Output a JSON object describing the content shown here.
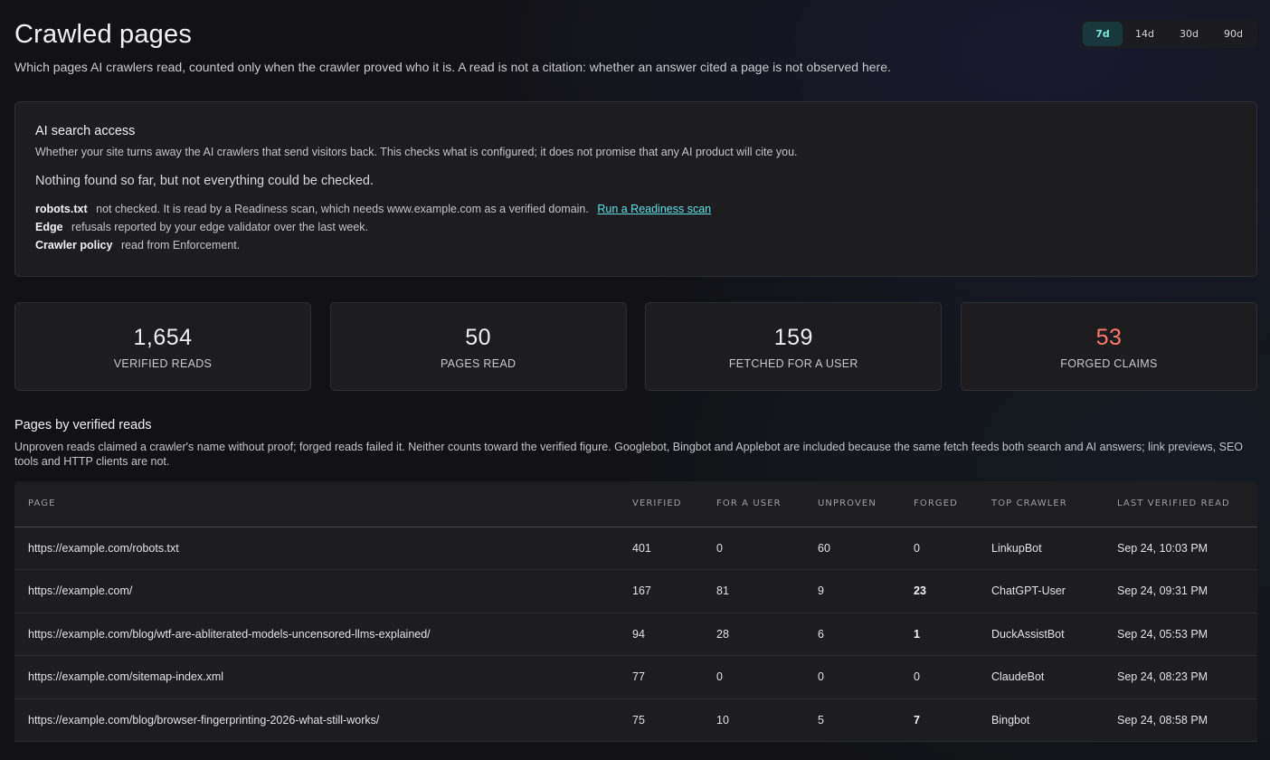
{
  "header": {
    "title": "Crawled pages",
    "subtitle": "Which pages AI crawlers read, counted only when the crawler proved who it is. A read is not a citation: whether an answer cited a page is not observed here.",
    "ranges": [
      "7d",
      "14d",
      "30d",
      "90d"
    ],
    "active_range": "7d"
  },
  "access": {
    "title": "AI search access",
    "description": "Whether your site turns away the AI crawlers that send visitors back. This checks what is configured; it does not promise that any AI product will cite you.",
    "summary": "Nothing found so far, but not everything could be checked.",
    "robots_label": "robots.txt",
    "robots_text": "not checked. It is read by a Readiness scan, which needs www.example.com as a verified domain.",
    "robots_link": "Run a Readiness scan",
    "edge_label": "Edge",
    "edge_text": "refusals reported by your edge validator over the last week.",
    "policy_label": "Crawler policy",
    "policy_text": "read from Enforcement."
  },
  "stats": {
    "verified_reads": "1,654",
    "verified_reads_label": "VERIFIED READS",
    "pages_read": "50",
    "pages_read_label": "PAGES READ",
    "fetched_for_user": "159",
    "fetched_for_user_label": "FETCHED FOR A USER",
    "forged_claims": "53",
    "forged_claims_label": "FORGED CLAIMS",
    "warn_color": "#ff7a70"
  },
  "pages": {
    "title": "Pages by verified reads",
    "note": "Unproven reads claimed a crawler's name without proof; forged reads failed it. Neither counts toward the verified figure. Googlebot, Bingbot and Applebot are included because the same fetch feeds both search and AI answers; link previews, SEO tools and HTTP clients are not.",
    "columns": [
      "PAGE",
      "VERIFIED",
      "FOR A USER",
      "UNPROVEN",
      "FORGED",
      "TOP CRAWLER",
      "LAST VERIFIED READ"
    ],
    "rows": [
      {
        "page": "https://example.com/robots.txt",
        "verified": "401",
        "for_user": "0",
        "unproven": "60",
        "forged": "0",
        "crawler": "LinkupBot",
        "last": "Sep 24, 10:03 PM"
      },
      {
        "page": "https://example.com/",
        "verified": "167",
        "for_user": "81",
        "unproven": "9",
        "forged": "23",
        "crawler": "ChatGPT-User",
        "last": "Sep 24, 09:31 PM"
      },
      {
        "page": "https://example.com/blog/wtf-are-abliterated-models-uncensored-llms-explained/",
        "verified": "94",
        "for_user": "28",
        "unproven": "6",
        "forged": "1",
        "crawler": "DuckAssistBot",
        "last": "Sep 24, 05:53 PM"
      },
      {
        "page": "https://example.com/sitemap-index.xml",
        "verified": "77",
        "for_user": "0",
        "unproven": "0",
        "forged": "0",
        "crawler": "ClaudeBot",
        "last": "Sep 24, 08:23 PM"
      },
      {
        "page": "https://example.com/blog/browser-fingerprinting-2026-what-still-works/",
        "verified": "75",
        "for_user": "10",
        "unproven": "5",
        "forged": "7",
        "crawler": "Bingbot",
        "last": "Sep 24, 08:58 PM"
      }
    ]
  }
}
